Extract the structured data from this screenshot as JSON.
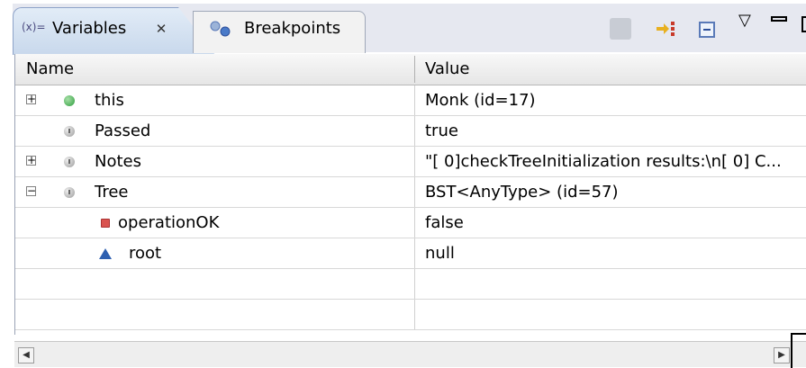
{
  "tabs": [
    {
      "label": "Variables",
      "icon": "variables-icon",
      "active": true
    },
    {
      "label": "Breakpoints",
      "icon": "breakpoints-icon",
      "active": false
    }
  ],
  "variables_icon_text": "(x)=",
  "columns": {
    "name": "Name",
    "value": "Value"
  },
  "rows": [
    {
      "name": "this",
      "value": "Monk  (id=17)",
      "expander": "+",
      "icon": "green-circle"
    },
    {
      "name": "Passed",
      "value": "true",
      "expander": "",
      "icon": "gray-circle"
    },
    {
      "name": "Notes",
      "value": "\"[ 0]checkTreeInitialization results:\\n[ 0]   C...",
      "expander": "+",
      "icon": "gray-circle"
    },
    {
      "name": "Tree",
      "value": "BST<AnyType>  (id=57)",
      "expander": "−",
      "icon": "gray-circle"
    },
    {
      "name": "operationOK",
      "value": "false",
      "expander": "",
      "icon": "red-square"
    },
    {
      "name": "root",
      "value": "null",
      "expander": "",
      "icon": "blue-triangle"
    },
    {
      "name": "",
      "value": "",
      "expander": "",
      "icon": ""
    },
    {
      "name": "",
      "value": "",
      "expander": "",
      "icon": ""
    }
  ],
  "colors": {
    "tab_active": "#c8d8ec",
    "header_bg": "#e6e6e6",
    "bullet_green": "#2e9e3e",
    "bullet_red": "#d9534f",
    "bullet_blue": "#2d5fb0"
  }
}
